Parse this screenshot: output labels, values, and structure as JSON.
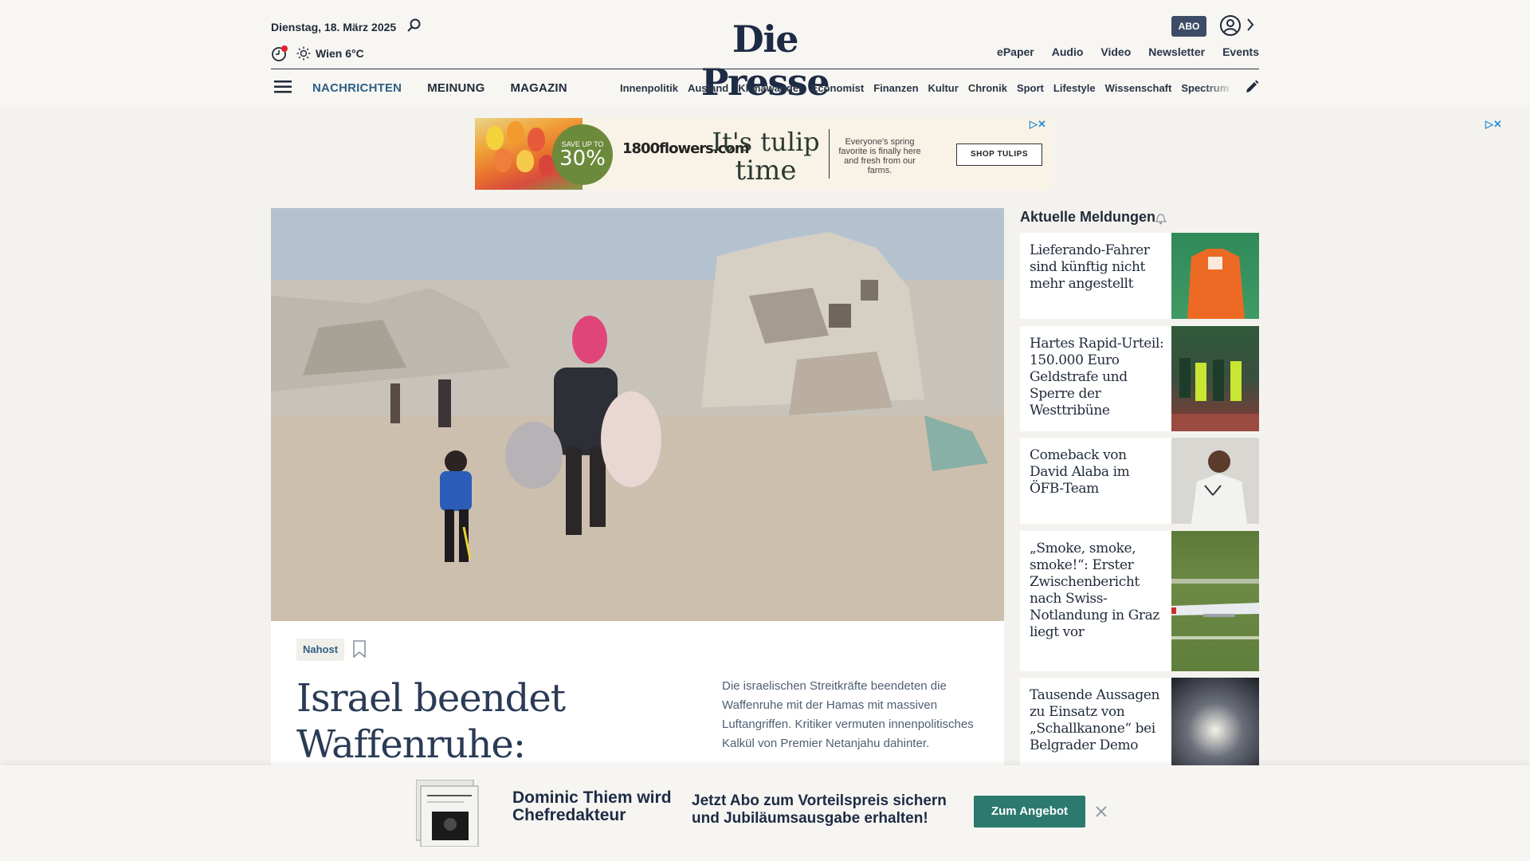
{
  "header": {
    "date": "Dienstag, 18. März 2025",
    "weather": "Wien 6°C",
    "logo": "Die Presse",
    "abo_label": "ABO",
    "top_links": [
      "ePaper",
      "Audio",
      "Video",
      "Newsletter",
      "Events"
    ]
  },
  "nav": {
    "main": [
      "NACHRICHTEN",
      "MEINUNG",
      "MAGAZIN"
    ],
    "sub": [
      "Innenpolitik",
      "Ausland",
      "Klimawandel",
      "Economist",
      "Finanzen",
      "Kultur",
      "Chronik",
      "Sport",
      "Lifestyle",
      "Wissenschaft",
      "Spectrum"
    ]
  },
  "ad": {
    "badge_small": "SAVE UP TO",
    "badge_big": "30%",
    "brand": "1800flowers.com",
    "headline_1": "It's tulip",
    "headline_2": "time",
    "copy": "Everyone's spring favorite is finally here and fresh from our farms.",
    "cta": "SHOP TULIPS"
  },
  "lead": {
    "tag": "Nahost",
    "title": "Israel beendet Waffenruhe:",
    "teaser": "Die israelischen Streitkräfte beendeten die Waffenruhe mit der Hamas mit massiven Luftangriffen. Kritiker vermuten innenpolitisches Kalkül von Premier Netanjahu dahinter."
  },
  "sidebar": {
    "title": "Aktuelle Meldungen",
    "items": [
      {
        "title": "Lieferando-Fahrer sind künftig nicht mehr angestellt"
      },
      {
        "title": "Hartes Rapid-Urteil: 150.000 Euro Geldstrafe und Sperre der Westtribüne"
      },
      {
        "title": "Comeback von David Alaba im ÖFB-Team"
      },
      {
        "title": "„Smoke, smoke, smoke!“: Erster Zwischenbericht nach Swiss-Notlandung in Graz liegt vor"
      },
      {
        "title": "Tausende Aussagen zu Einsatz von „Schallkanone“ bei Belgrader Demo"
      }
    ]
  },
  "promo": {
    "name": "Dominic Thiem wird Chefredakteur",
    "text": "Jetzt Abo zum Vorteilspreis sichern und Jubiläumsausgabe erhalten!",
    "button": "Zum Angebot"
  },
  "colors": {
    "accent": "#2f5f86",
    "navy": "#1e2b45",
    "promo_button": "#2c7a6e"
  }
}
